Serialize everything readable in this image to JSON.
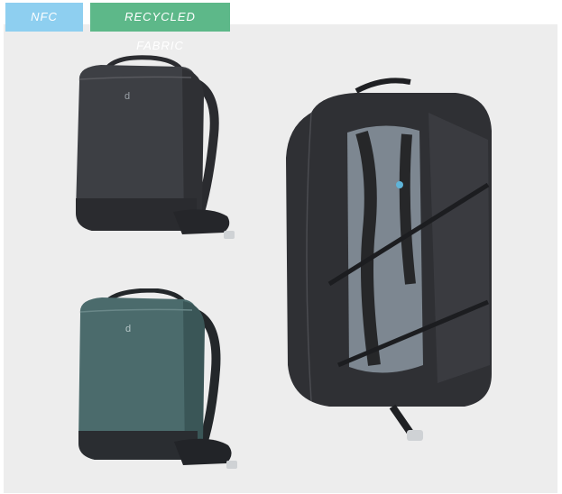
{
  "badges": [
    {
      "label": "NFC",
      "color": "#8ecff0"
    },
    {
      "label": "RECYCLED FABRIC",
      "color": "#5db889"
    }
  ],
  "products": [
    {
      "name": "backpack-black-closed",
      "icon": "backpack-icon",
      "color": "#3d3f44"
    },
    {
      "name": "backpack-teal-closed",
      "icon": "backpack-icon",
      "color": "#4b6b6c"
    },
    {
      "name": "backpack-black-open",
      "icon": "open-backpack-icon",
      "color": "#2f3034"
    }
  ],
  "colors": {
    "panel_bg": "#ededed",
    "harness_gray": "#7d8791",
    "accent_blue": "#5fb4d8"
  }
}
